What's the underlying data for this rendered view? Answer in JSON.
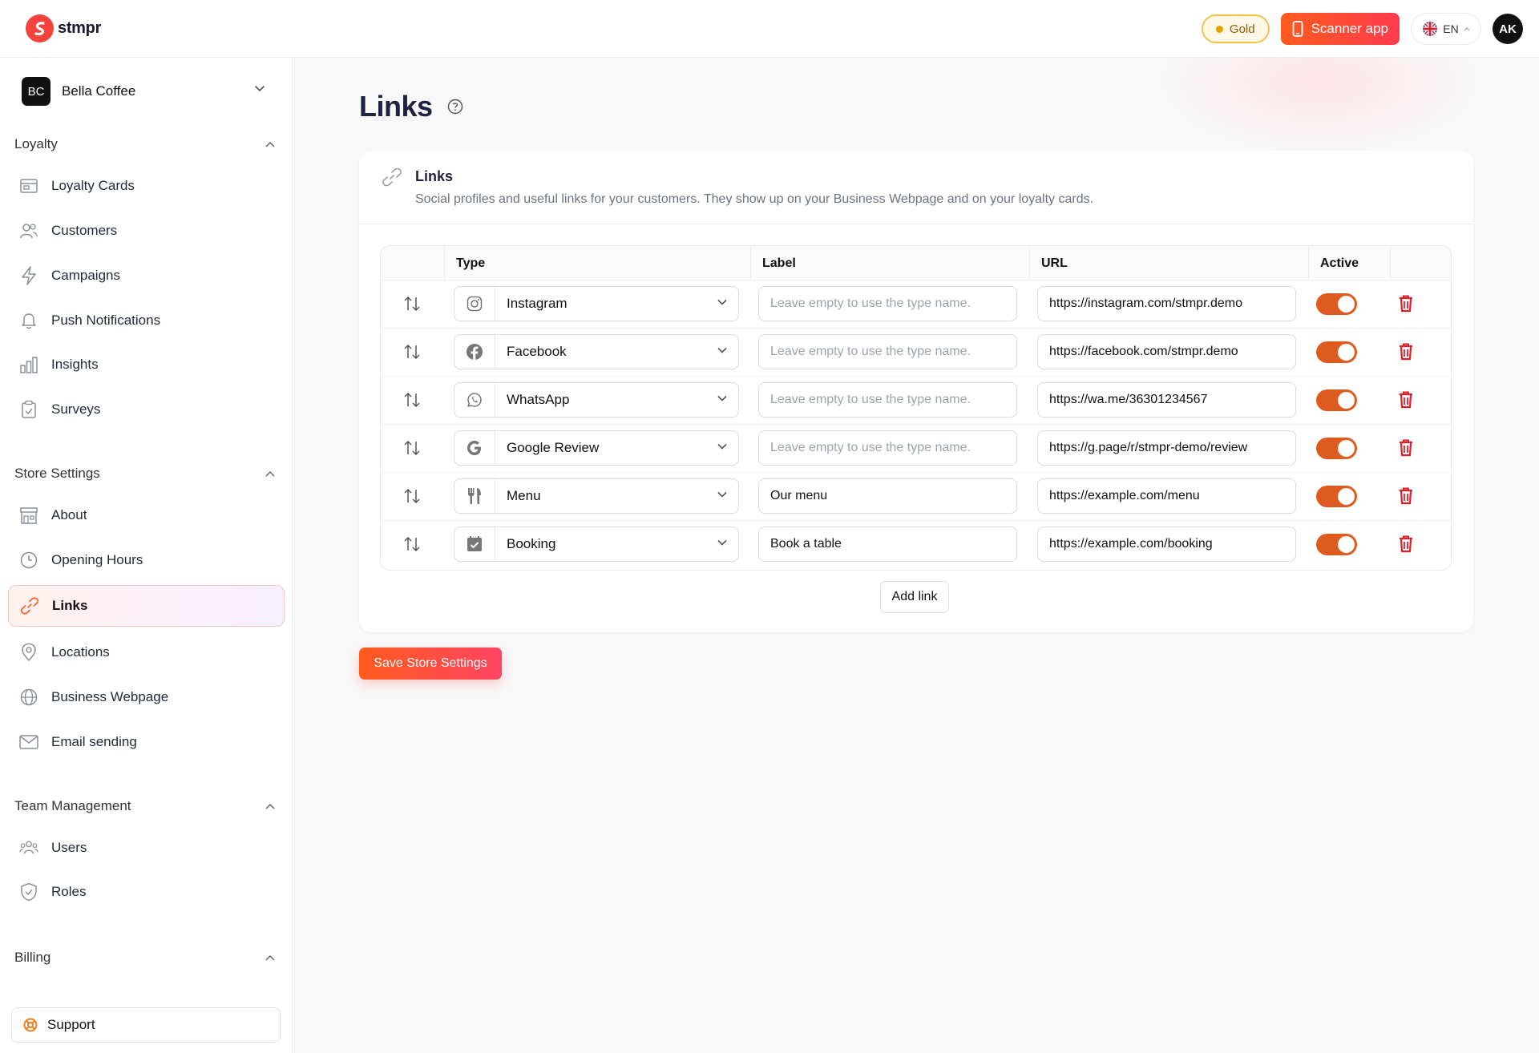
{
  "app": {
    "logo_text": "stmpr"
  },
  "topbar": {
    "plan": "Gold",
    "scanner_label": "Scanner app",
    "language": "EN",
    "user_initials": "AK"
  },
  "store": {
    "initials": "BC",
    "name": "Bella Coffee"
  },
  "sidebar": {
    "sections": [
      {
        "title": "Loyalty",
        "items": [
          {
            "label": "Loyalty Cards",
            "icon": "loyalty-card-icon"
          },
          {
            "label": "Customers",
            "icon": "customers-icon"
          },
          {
            "label": "Campaigns",
            "icon": "bolt-icon"
          },
          {
            "label": "Push Notifications",
            "icon": "bell-icon"
          },
          {
            "label": "Insights",
            "icon": "bar-chart-icon"
          },
          {
            "label": "Surveys",
            "icon": "clipboard-icon"
          }
        ]
      },
      {
        "title": "Store Settings",
        "items": [
          {
            "label": "About",
            "icon": "store-icon"
          },
          {
            "label": "Opening Hours",
            "icon": "clock-icon"
          },
          {
            "label": "Links",
            "icon": "link-icon",
            "active": true
          },
          {
            "label": "Locations",
            "icon": "location-pin-icon"
          },
          {
            "label": "Business Webpage",
            "icon": "globe-icon"
          },
          {
            "label": "Email sending",
            "icon": "envelope-icon"
          }
        ]
      },
      {
        "title": "Team Management",
        "items": [
          {
            "label": "Users",
            "icon": "users-icon"
          },
          {
            "label": "Roles",
            "icon": "shield-icon"
          }
        ]
      },
      {
        "title": "Billing",
        "items": []
      }
    ],
    "support_label": "Support"
  },
  "page": {
    "title": "Links"
  },
  "links_card": {
    "title": "Links",
    "description": "Social profiles and useful links for your customers. They show up on your Business Webpage and on your loyalty cards.",
    "columns": [
      "Type",
      "Label",
      "URL",
      "Active"
    ],
    "label_placeholder": "Leave empty to use the type name.",
    "rows": [
      {
        "type": "Instagram",
        "icon": "instagram-icon",
        "label": "",
        "url": "https://instagram.com/stmpr.demo",
        "active": true
      },
      {
        "type": "Facebook",
        "icon": "facebook-icon",
        "label": "",
        "url": "https://facebook.com/stmpr.demo",
        "active": true
      },
      {
        "type": "WhatsApp",
        "icon": "whatsapp-icon",
        "label": "",
        "url": "https://wa.me/36301234567",
        "active": true
      },
      {
        "type": "Google Review",
        "icon": "google-icon",
        "label": "",
        "url": "https://g.page/r/stmpr-demo/review",
        "active": true
      },
      {
        "type": "Menu",
        "icon": "fork-knife-icon",
        "label": "Our menu",
        "url": "https://example.com/menu",
        "active": true
      },
      {
        "type": "Booking",
        "icon": "calendar-check-icon",
        "label": "Book a table",
        "url": "https://example.com/booking",
        "active": true
      }
    ],
    "add_label": "Add link"
  },
  "save_label": "Save Store Settings",
  "colors": {
    "accent": "#ff5a1f",
    "toggle_on": "#de5b1f",
    "danger": "#e11d2a",
    "gold": "#f2c14e"
  }
}
